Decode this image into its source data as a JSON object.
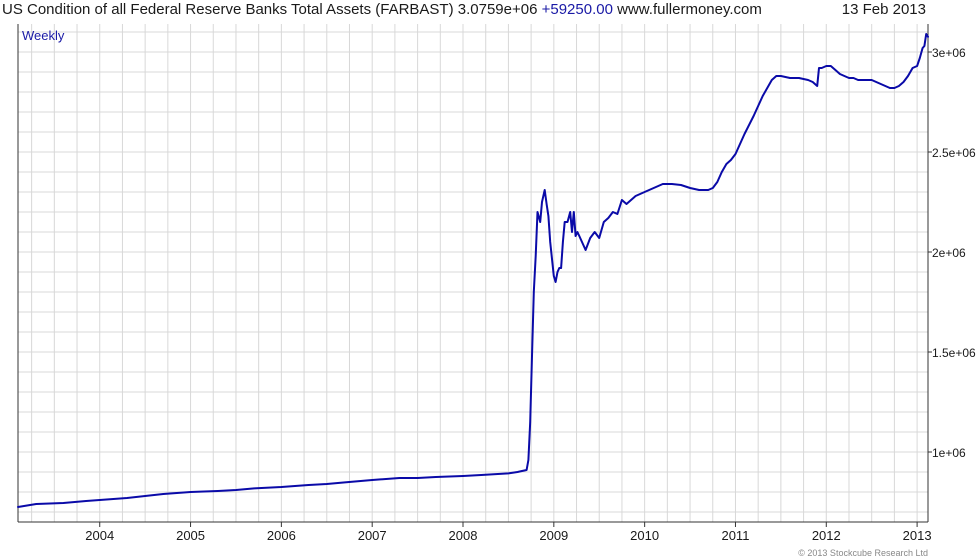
{
  "header": {
    "title": "US Condition of all Federal Reserve Banks Total Assets (FARBAST)",
    "value": "3.0759e+06",
    "change": "+59250.00",
    "site": "www.fullermoney.com",
    "date": "13 Feb 2013"
  },
  "frequency_label": "Weekly",
  "copyright": "© 2013 Stockcube Research Ltd",
  "colors": {
    "line": "#0a0aa8",
    "grid": "#d8d8d8",
    "axis": "#333333",
    "frequency_label": "#1a1aa6",
    "change": "#1a1aa6"
  },
  "chart_data": {
    "type": "line",
    "title": "US Condition of all Federal Reserve Banks Total Assets (FARBAST)",
    "xlabel": "",
    "ylabel": "",
    "xlim": [
      2003.1,
      2013.12
    ],
    "ylim": [
      650000,
      3140000
    ],
    "x_ticks": [
      {
        "value": 2004.0,
        "label": "2004"
      },
      {
        "value": 2005.0,
        "label": "2005"
      },
      {
        "value": 2006.0,
        "label": "2006"
      },
      {
        "value": 2007.0,
        "label": "2007"
      },
      {
        "value": 2008.0,
        "label": "2008"
      },
      {
        "value": 2009.0,
        "label": "2009"
      },
      {
        "value": 2010.0,
        "label": "2010"
      },
      {
        "value": 2011.0,
        "label": "2011"
      },
      {
        "value": 2012.0,
        "label": "2012"
      },
      {
        "value": 2013.0,
        "label": "2013"
      }
    ],
    "y_ticks": [
      {
        "value": 1000000,
        "label": "1e+06"
      },
      {
        "value": 1500000,
        "label": "1.5e+06"
      },
      {
        "value": 2000000,
        "label": "2e+06"
      },
      {
        "value": 2500000,
        "label": "2.5e+06"
      },
      {
        "value": 3000000,
        "label": "3e+06"
      }
    ],
    "grid": true,
    "series": [
      {
        "x": [
          2003.1,
          2003.3,
          2003.6,
          2003.85,
          2004.0,
          2004.3,
          2004.5,
          2004.7,
          2005.0,
          2005.3,
          2005.5,
          2005.7,
          2006.0,
          2006.3,
          2006.5,
          2006.7,
          2007.0,
          2007.3,
          2007.5,
          2007.7,
          2008.0,
          2008.2,
          2008.5,
          2008.6,
          2008.65,
          2008.7,
          2008.72,
          2008.74,
          2008.76,
          2008.78,
          2008.8,
          2008.82,
          2008.85,
          2008.87,
          2008.9,
          2008.92,
          2008.94,
          2008.96,
          2009.0,
          2009.02,
          2009.04,
          2009.06,
          2009.08,
          2009.1,
          2009.12,
          2009.15,
          2009.18,
          2009.2,
          2009.22,
          2009.24,
          2009.26,
          2009.28,
          2009.3,
          2009.32,
          2009.35,
          2009.4,
          2009.45,
          2009.5,
          2009.55,
          2009.6,
          2009.65,
          2009.7,
          2009.75,
          2009.8,
          2009.9,
          2010.0,
          2010.1,
          2010.2,
          2010.3,
          2010.4,
          2010.5,
          2010.6,
          2010.7,
          2010.75,
          2010.8,
          2010.85,
          2010.9,
          2010.95,
          2011.0,
          2011.1,
          2011.2,
          2011.3,
          2011.4,
          2011.45,
          2011.5,
          2011.6,
          2011.7,
          2011.8,
          2011.85,
          2011.9,
          2011.92,
          2011.95,
          2012.0,
          2012.05,
          2012.1,
          2012.15,
          2012.2,
          2012.25,
          2012.3,
          2012.35,
          2012.4,
          2012.5,
          2012.6,
          2012.7,
          2012.75,
          2012.8,
          2012.85,
          2012.9,
          2012.95,
          2013.0,
          2013.03,
          2013.06,
          2013.08,
          2013.1,
          2013.12
        ],
        "y": [
          725000,
          740000,
          745000,
          755000,
          760000,
          770000,
          780000,
          790000,
          800000,
          805000,
          810000,
          818000,
          825000,
          835000,
          840000,
          848000,
          860000,
          870000,
          870000,
          875000,
          880000,
          885000,
          893000,
          900000,
          905000,
          910000,
          960000,
          1150000,
          1480000,
          1800000,
          1980000,
          2200000,
          2150000,
          2250000,
          2310000,
          2240000,
          2180000,
          2050000,
          1880000,
          1850000,
          1900000,
          1920000,
          1920000,
          2050000,
          2150000,
          2150000,
          2200000,
          2100000,
          2200000,
          2080000,
          2100000,
          2080000,
          2060000,
          2040000,
          2010000,
          2070000,
          2100000,
          2070000,
          2150000,
          2170000,
          2200000,
          2190000,
          2260000,
          2240000,
          2280000,
          2300000,
          2320000,
          2340000,
          2340000,
          2335000,
          2320000,
          2310000,
          2310000,
          2320000,
          2350000,
          2400000,
          2440000,
          2460000,
          2490000,
          2590000,
          2680000,
          2780000,
          2860000,
          2880000,
          2880000,
          2870000,
          2870000,
          2860000,
          2850000,
          2830000,
          2920000,
          2920000,
          2930000,
          2930000,
          2910000,
          2890000,
          2880000,
          2870000,
          2870000,
          2860000,
          2860000,
          2860000,
          2840000,
          2820000,
          2820000,
          2830000,
          2850000,
          2880000,
          2920000,
          2930000,
          2970000,
          3020000,
          3030000,
          3090000,
          3076000
        ]
      }
    ]
  }
}
